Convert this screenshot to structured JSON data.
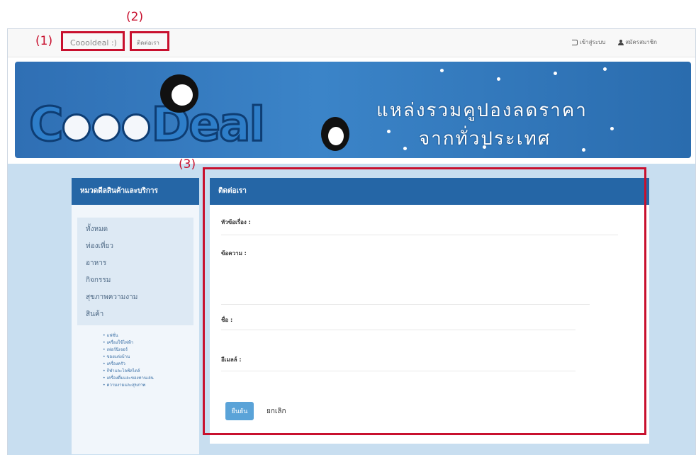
{
  "annotations": {
    "label1": "(1)",
    "label2": "(2)",
    "label3": "(3)"
  },
  "navbar": {
    "brand": "Coooldeal :)",
    "contact_link": "ติดต่อเรา",
    "login": "เข้าสู่ระบบ",
    "register": "สมัครสมาชิก"
  },
  "banner": {
    "logo_c": "C",
    "logo_rest": "Deal",
    "slogan_line1": "แหล่งรวมคูปองลดราคา",
    "slogan_line2": "จากทั่วประเทศ"
  },
  "sidebar": {
    "title": "หมวดดีลสินค้าและบริการ",
    "items": [
      "ทั้งหมด",
      "ท่องเที่ยว",
      "อาหาร",
      "กิจกรรม",
      "สุขภาพความงาม",
      "สินค้า"
    ],
    "sub_items": [
      "แฟชั่น",
      "เครื่องใช้ไฟฟ้า",
      "เฟอร์นิเจอร์",
      "ของแต่งบ้าน",
      "เครื่องครัว",
      "กีฬาและไลฟ์สไตล์",
      "เครื่องดื่มและของทานเล่น",
      "ความงามและสุขภาพ"
    ]
  },
  "form": {
    "title": "ติดต่อเรา",
    "subject_label": "หัวข้อเรื่อง :",
    "message_label": "ข้อความ :",
    "name_label": "ชื่อ :",
    "email_label": "อีเมลล์ :",
    "submit": "ยืนยัน",
    "cancel": "ยกเลิก"
  },
  "colors": {
    "accent": "#2566a6",
    "annotation": "#c8102e",
    "button": "#5aa3d8"
  }
}
